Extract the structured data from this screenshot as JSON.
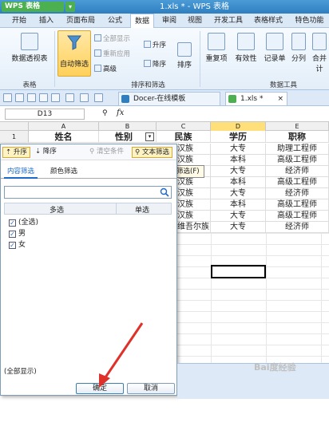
{
  "app": {
    "logo_text": "WPS 表格",
    "window_title": "1.xls * - WPS 表格"
  },
  "menu": {
    "tabs": [
      "开始",
      "插入",
      "页面布局",
      "公式",
      "数据",
      "审阅",
      "视图",
      "开发工具",
      "表格样式",
      "特色功能"
    ],
    "active": "数据"
  },
  "ribbon": {
    "pivot": "数据透视表",
    "autofilter": "自动筛选",
    "show_all": "全部显示",
    "reapply": "重新应用",
    "advanced": "高级",
    "sort_asc": "升序",
    "sort_desc": "降序",
    "sort": "排序",
    "duplicates": "重复项",
    "validity": "有效性",
    "record_form": "记录单",
    "split": "分列",
    "consolidate": "合并计",
    "group_table": "表格",
    "group_sort_filter": "排序和筛选",
    "group_data_tools": "数据工具"
  },
  "doc_tabs": [
    {
      "label": "Docer-在线模板"
    },
    {
      "label": "1.xls *"
    }
  ],
  "formula_bar": {
    "cell_ref": "D13",
    "fx": "fx"
  },
  "columns": [
    "A",
    "B",
    "C",
    "D",
    "E"
  ],
  "sheet": {
    "row1_number": "1",
    "headers": [
      "姓名",
      "性别",
      "民族",
      "学历",
      "职称"
    ],
    "col_c_visible": [
      "汉族",
      "汉族",
      "汉族",
      "汉族",
      "汉族",
      "汉族",
      "汉族",
      "维吾尔族"
    ],
    "col_d": [
      "大专",
      "本科",
      "大专",
      "本科",
      "大专",
      "本科",
      "大专",
      "大专"
    ],
    "col_e": [
      "助理工程师",
      "高级工程师",
      "经济师",
      "高级工程师",
      "经济师",
      "高级工程师",
      "高级工程师",
      "经济师"
    ]
  },
  "tooltip": "文本筛选(F)",
  "filter_panel": {
    "asc": "升序",
    "desc": "降序",
    "clear": "清空条件",
    "text_filter": "文本筛选",
    "tab_content": "内容筛选",
    "tab_color": "颜色筛选",
    "search_value": "",
    "col_multi": "多选",
    "col_single": "单选",
    "items": [
      {
        "label": "(全选)",
        "checked": true
      },
      {
        "label": "男",
        "checked": true
      },
      {
        "label": "女",
        "checked": true
      }
    ],
    "status": "(全部显示)",
    "ok": "确定",
    "cancel": "取消"
  },
  "watermark": "Bai度经验",
  "colors": {
    "accent": "#2f7fc0",
    "highlight": "#ffd05a",
    "arrow": "#e0302a"
  }
}
